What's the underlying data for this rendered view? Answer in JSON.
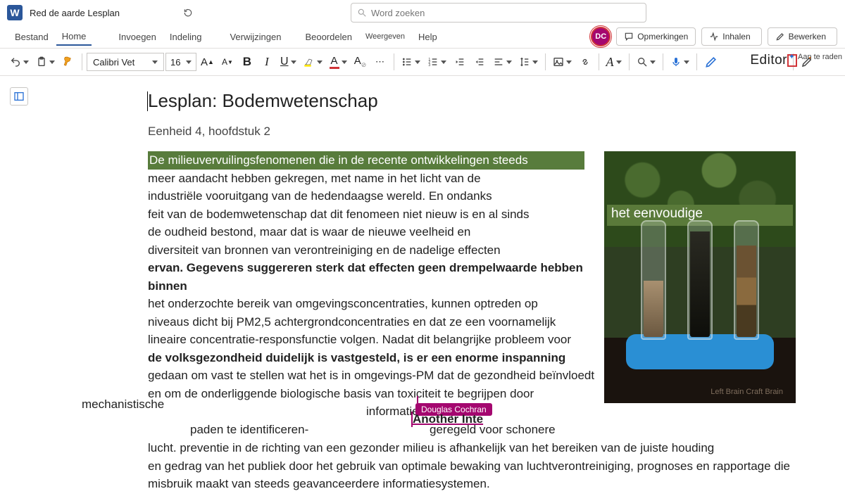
{
  "titlebar": {
    "doc_title": "Red de aarde Lesplan",
    "autosave_label": "",
    "search_placeholder": "Word zoeken"
  },
  "menus": {
    "file": "Bestand",
    "home": "Home",
    "insert": "Invoegen",
    "layout": "Indeling",
    "references": "Verwijzingen",
    "review": "Beoordelen",
    "view": "Weergeven",
    "help": "Help"
  },
  "right_buttons": {
    "avatar_initials": "DC",
    "comments": "Opmerkingen",
    "catchup": "Inhalen",
    "editing": "Bewerken"
  },
  "ribbon": {
    "font_name": "Calibri Vet",
    "font_size": "16",
    "editor_label": "Editor"
  },
  "document": {
    "heading": "Lesplan: Bodemwetenschap",
    "subheading": "Eenheid 4, hoofdstuk 2",
    "hl_line": "De milieuvervuilingsfenomenen die in de recente ontwikkelingen steeds",
    "p1_l2": "meer aandacht hebben gekregen, met name in het licht van de",
    "p1_l3": "industriële vooruitgang van de hedendaagse wereld. En ondanks",
    "p1_img_banner": "het eenvoudige",
    "p1_l4": "feit van de bodemwetenschap dat dit fenomeen niet nieuw is en al sinds",
    "p1_l5": "de oudheid bestond, maar dat is waar de nieuwe veelheid en",
    "p1_l6": "diversiteit van bronnen van verontreiniging en de nadelige effecten",
    "p1_l7_bold": "ervan. Gegevens suggereren sterk dat effecten geen drempelwaarde hebben binnen",
    "p1_l8": "het onderzochte bereik van omgevingsconcentraties, kunnen optreden op",
    "p1_l9": "niveaus dicht bij PM2,5 achtergrondconcentraties en dat ze een voornamelijk",
    "p1_l10": "lineaire concentratie-responsfunctie volgen. Nadat dit belangrijke probleem voor",
    "p1_l11_bold": "de volksgezondheid duidelijk is vastgesteld, is er een enorme inspanning",
    "p1_l12": "gedaan om vast te stellen wat het is in omgevings-PM dat de gezondheid beïnvloedt",
    "p1_l13": "en om de onderliggende biologische basis van toxiciteit te begrijpen door",
    "frag_mech": "mechanistische",
    "frag_info": "informatie die bij",
    "frag_paths": "paden te identificeren-",
    "frag_regel": "geregeld voor schonere",
    "p1_l17": "lucht. preventie in de richting van een gezonder milieu is afhankelijk van het bereiken van de juiste houding",
    "p1_l18": "en gedrag van het publiek door het gebruik van optimale bewaking van luchtverontreiniging, prognoses en rapportage die",
    "p1_l19": "misbruik maakt van steeds geavanceerdere informatiesystemen.",
    "watermark": "Left Brain Craft Brain"
  },
  "collab": {
    "name": "Douglas Cochran",
    "inline_text": "Another Inte"
  },
  "designer": {
    "label": "Aan te raden"
  }
}
